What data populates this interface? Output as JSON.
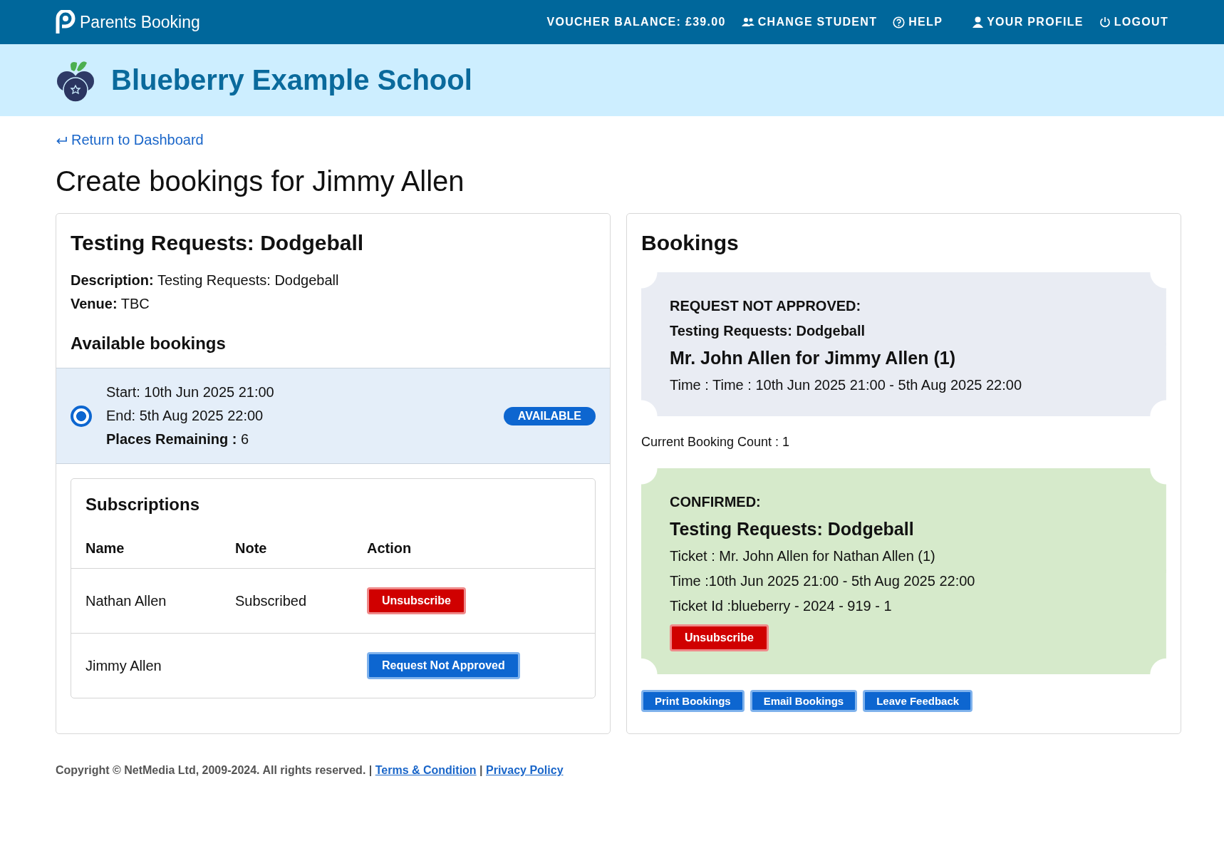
{
  "nav": {
    "brand": "Parents Booking",
    "items": [
      {
        "kind": "text",
        "label": "VOUCHER BALANCE: £39.00"
      },
      {
        "kind": "people",
        "label": "CHANGE STUDENT"
      },
      {
        "kind": "help",
        "label": "HELP"
      },
      {
        "kind": "person",
        "label": "YOUR PROFILE"
      },
      {
        "kind": "power",
        "label": "LOGOUT"
      }
    ]
  },
  "school": {
    "name": "Blueberry Example School"
  },
  "back_link": "Return to Dashboard",
  "page_title": "Create bookings for Jimmy Allen",
  "event": {
    "title": "Testing Requests: Dodgeball",
    "description_label": "Description:",
    "description": "Testing Requests: Dodgeball",
    "venue_label": "Venue:",
    "venue": "TBC",
    "available_heading": "Available bookings",
    "slots": [
      {
        "start": "Start: 10th Jun 2025 21:00",
        "end": "End: 5th Aug 2025 22:00",
        "places_label": "Places Remaining :",
        "places": "6",
        "badge": "AVAILABLE",
        "selected": true
      }
    ]
  },
  "subscriptions": {
    "title": "Subscriptions",
    "columns": [
      "Name",
      "Note",
      "Action"
    ],
    "rows": [
      {
        "name": "Nathan Allen",
        "note": "Subscribed",
        "action": "Unsubscribe",
        "kind": "danger"
      },
      {
        "name": "Jimmy Allen",
        "note": "",
        "action": "Request Not Approved",
        "kind": "primary"
      }
    ]
  },
  "bookings": {
    "title": "Bookings",
    "blocks": [
      {
        "kind": "ticket",
        "color": "#e9ecf3",
        "lines": [
          {
            "kind": "status",
            "text": "REQUEST NOT APPROVED:"
          },
          {
            "kind": "bold",
            "text": "Testing Requests: Dodgeball"
          },
          {
            "kind": "heading",
            "text": "Mr. John Allen for Jimmy Allen (1)"
          },
          {
            "kind": "plain",
            "text": "Time : Time : 10th Jun 2025 21:00 - 5th Aug 2025 22:00"
          }
        ]
      },
      {
        "kind": "count",
        "text": "Current Booking Count : 1"
      },
      {
        "kind": "ticket",
        "color": "#d6eacb",
        "lines": [
          {
            "kind": "status",
            "text": "CONFIRMED:"
          },
          {
            "kind": "heading",
            "text": "Testing Requests: Dodgeball"
          },
          {
            "kind": "plain",
            "text": "Ticket : Mr. John Allen for Nathan Allen (1)"
          },
          {
            "kind": "plain",
            "text": "Time :10th Jun 2025 21:00 - 5th Aug 2025 22:00"
          },
          {
            "kind": "plain",
            "text": "Ticket Id :blueberry - 2024 - 919 - 1"
          }
        ],
        "button": "Unsubscribe"
      }
    ],
    "actions": [
      "Print Bookings",
      "Email Bookings",
      "Leave Feedback"
    ]
  },
  "footer": [
    {
      "kind": "text",
      "text": "Copyright © NetMedia Ltd, 2009-2024. All rights reserved. |"
    },
    {
      "kind": "link",
      "text": "Terms & Condition"
    },
    {
      "kind": "text",
      "text": "|"
    },
    {
      "kind": "link",
      "text": "Privacy Policy"
    }
  ]
}
